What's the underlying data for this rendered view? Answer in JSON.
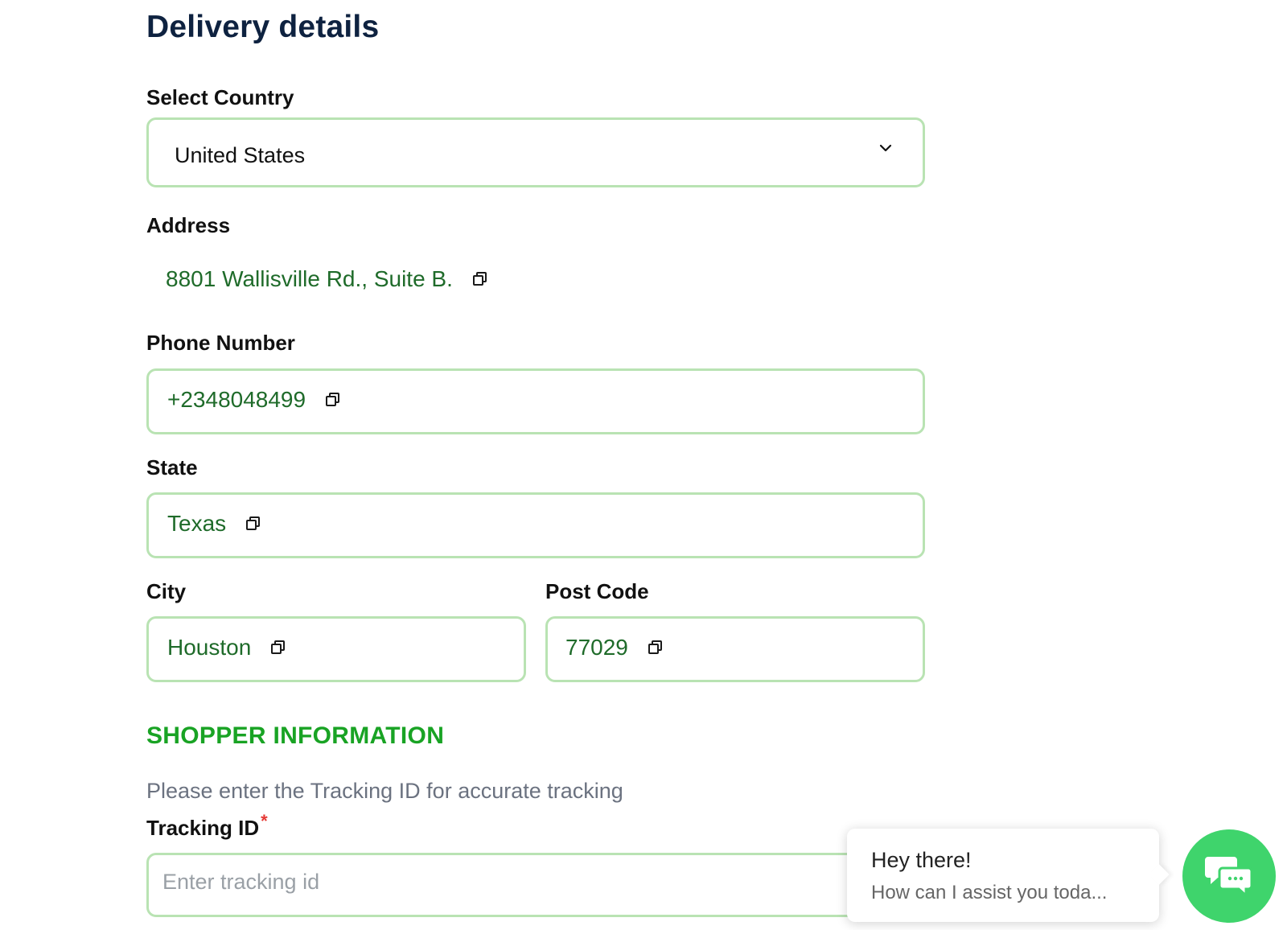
{
  "page_title": "Delivery details",
  "country": {
    "label": "Select Country",
    "selected": "United States",
    "icon": "chevron-down-icon"
  },
  "address": {
    "label": "Address",
    "value": "8801 Wallisville Rd., Suite B."
  },
  "phone": {
    "label": "Phone Number",
    "value": "+2348048499"
  },
  "state": {
    "label": "State",
    "value": "Texas"
  },
  "city": {
    "label": "City",
    "value": "Houston"
  },
  "post_code": {
    "label": "Post Code",
    "value": "77029"
  },
  "shopper": {
    "heading": "SHOPPER INFORMATION",
    "helper": "Please enter the Tracking ID for accurate tracking",
    "tracking_label": "Tracking ID",
    "required_mark": "*",
    "tracking_placeholder": "Enter tracking id"
  },
  "chat": {
    "greeting": "Hey there!",
    "question": "How can I assist you toda..."
  },
  "colors": {
    "title": "#0e2240",
    "accent_green": "#19a324",
    "value_green": "#1f6b2a",
    "input_border": "#b9e3b3",
    "chat_button": "#3fd46c",
    "required": "#e53935"
  },
  "icons": {
    "copy": "copy-icon",
    "chat": "chat-bubbles-icon"
  }
}
